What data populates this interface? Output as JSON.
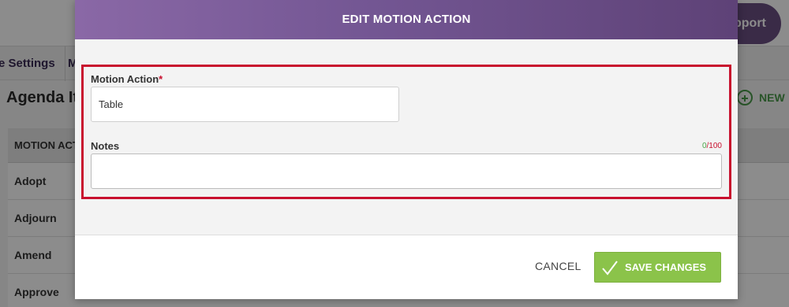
{
  "background": {
    "support_button": "pport",
    "tabs": [
      "e Settings",
      "M"
    ],
    "heading": "Agenda It",
    "new_button": "NEW",
    "table": {
      "header": "MOTION ACTIO",
      "rows": [
        "Adopt",
        "Adjourn",
        "Amend",
        "Approve"
      ]
    }
  },
  "modal": {
    "title": "EDIT MOTION ACTION",
    "motion_action": {
      "label": "Motion Action",
      "required_marker": "*",
      "value": "Table"
    },
    "notes": {
      "label": "Notes",
      "counter_current": "0",
      "counter_max": "/100",
      "value": ""
    },
    "footer": {
      "cancel_label": "CANCEL",
      "save_label": "SAVE CHANGES"
    }
  },
  "colors": {
    "header_gradient_start": "#8a68a6",
    "header_gradient_end": "#5e4277",
    "highlight_border": "#c8102e",
    "save_button": "#8bc34a",
    "required": "#c8102e"
  },
  "icons": {
    "save": "check-icon",
    "new": "plus-circle-icon"
  }
}
